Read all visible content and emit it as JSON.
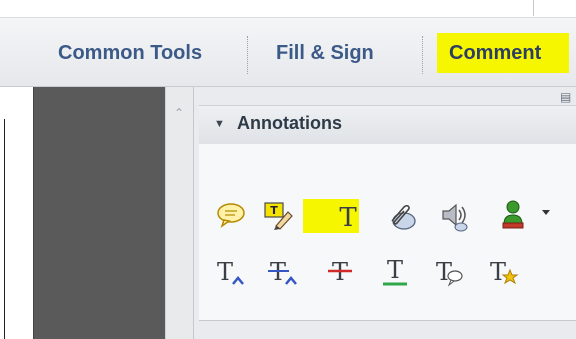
{
  "toolbar": {
    "tabs": [
      {
        "label": "Common Tools"
      },
      {
        "label": "Fill & Sign"
      },
      {
        "label": "Comment",
        "highlighted": true
      }
    ],
    "highlight_color": "#f6f600"
  },
  "annotations_panel": {
    "title": "Annotations",
    "row1_icons": [
      "sticky-note-icon",
      "highlight-text-icon",
      "add-text-icon",
      "attach-file-icon",
      "record-audio-icon",
      "stamp-icon"
    ],
    "row2_icons": [
      "insert-text-icon",
      "replace-text-icon",
      "strikethrough-icon",
      "underline-icon",
      "text-callout-icon",
      "text-correction-icon"
    ],
    "text_glyph": "T"
  }
}
